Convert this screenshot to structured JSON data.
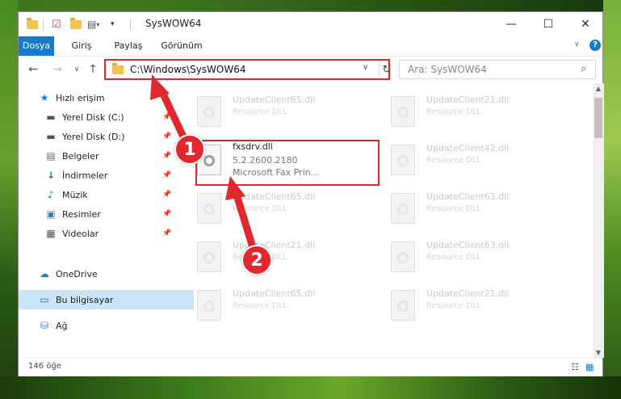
{
  "window": {
    "title": "SysWOW64"
  },
  "ribbon": {
    "tabs": [
      "Dosya",
      "Giriş",
      "Paylaş",
      "Görünüm"
    ]
  },
  "address": {
    "path": "C:\\Windows\\SysWOW64"
  },
  "search": {
    "placeholder": "Ara: SysWOW64"
  },
  "sidebar": {
    "items": [
      {
        "label": "Hızlı erişim",
        "icon": "star-icon"
      },
      {
        "label": "Yerel Disk (C:)",
        "icon": "drive-icon",
        "pinned": true
      },
      {
        "label": "Yerel Disk (D:)",
        "icon": "drive-icon",
        "pinned": true
      },
      {
        "label": "Belgeler",
        "icon": "document-icon",
        "pinned": true
      },
      {
        "label": "İndirmeler",
        "icon": "download-icon",
        "pinned": true
      },
      {
        "label": "Müzik",
        "icon": "music-icon",
        "pinned": true
      },
      {
        "label": "Resimler",
        "icon": "pictures-icon",
        "pinned": true
      },
      {
        "label": "Videolar",
        "icon": "video-icon",
        "pinned": true
      },
      {
        "label": "OneDrive",
        "icon": "cloud-icon"
      },
      {
        "label": "Bu bilgisayar",
        "icon": "computer-icon",
        "selected": true
      },
      {
        "label": "Ağ",
        "icon": "network-icon"
      }
    ]
  },
  "files": [
    {
      "name": "UpdateClient65.dll",
      "desc": "Resource DLL"
    },
    {
      "name": "UpdateClient21.dll",
      "desc": "Resource DLL"
    },
    {
      "name": "UpdateClient42.dll",
      "desc": "Resource DLL"
    },
    {
      "name": "UpdateClient65.dll",
      "desc": "Resource DLL"
    },
    {
      "name": "UpdateClient63.dll",
      "desc": "Resource DLL"
    },
    {
      "name": "UpdateClient21.dll",
      "desc": "Resource DLL"
    },
    {
      "name": "UpdateClient63.dll",
      "desc": "Resource DLL"
    },
    {
      "name": "UpdateClient65.dll",
      "desc": "Resource DLL"
    },
    {
      "name": "UpdateClient21.dll",
      "desc": "Resource DLL"
    }
  ],
  "focused_file": {
    "name": "fxsdrv.dll",
    "version": "5.2.2600.2180",
    "company": "Microsoft  Fax Prin..."
  },
  "status": {
    "count": "146 öğe"
  },
  "annotations": {
    "marker1": "1",
    "marker2": "2"
  },
  "colors": {
    "accent": "#1979ca",
    "highlight": "#e0282f",
    "selected": "#cce4f7"
  }
}
